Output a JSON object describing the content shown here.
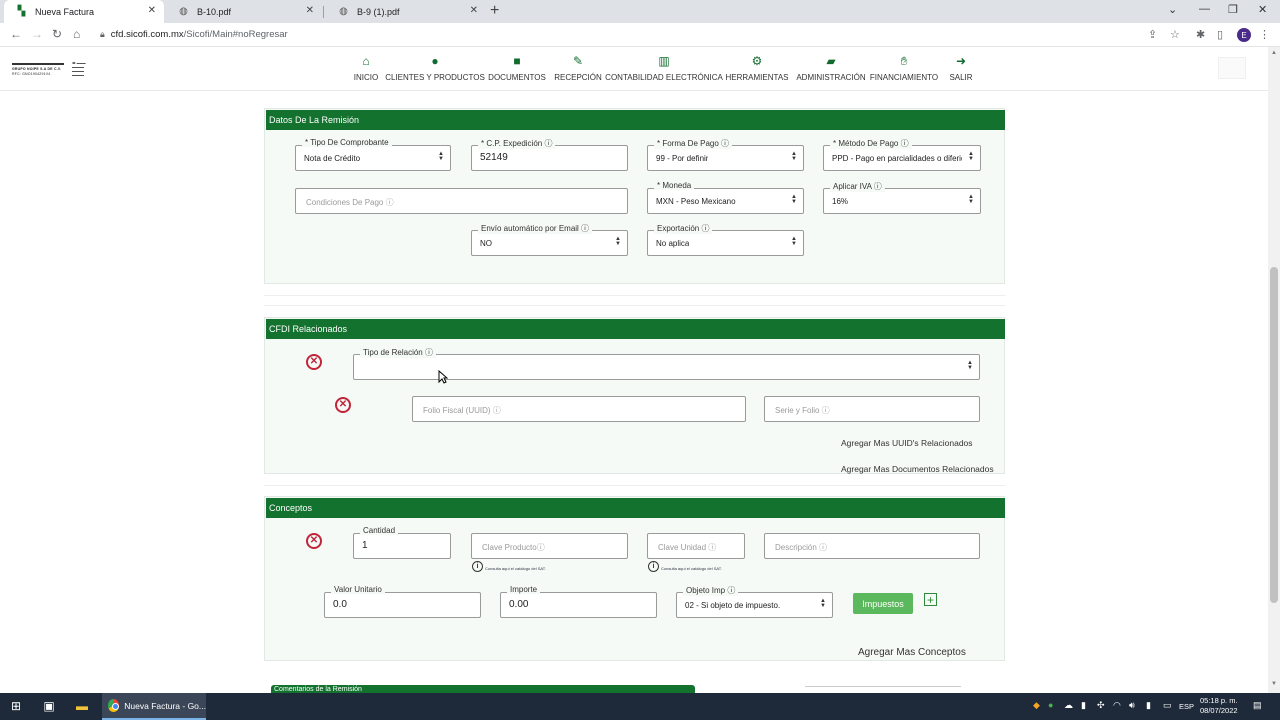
{
  "browser": {
    "tabs": [
      {
        "title": "Nueva Factura",
        "active": true
      },
      {
        "title": "B-10.pdf",
        "active": false
      },
      {
        "title": "B-9 (1).pdf",
        "active": false
      }
    ],
    "url_host": "cfd.sicofi.com.mx",
    "url_path": "/Sicofi/Main#noRegresar",
    "profile_initial": "E"
  },
  "header": {
    "logo_text": "GRUPO NOIPE S.A DE C.V.",
    "logo_subtext": "RFC: GNO1904291V4",
    "nav": [
      {
        "label": "INICIO",
        "icon": "home-icon"
      },
      {
        "label": "CLIENTES Y PRODUCTOS",
        "icon": "user-icon"
      },
      {
        "label": "DOCUMENTOS",
        "icon": "folder-icon"
      },
      {
        "label": "RECEPCIÓN",
        "icon": "edit-icon"
      },
      {
        "label": "CONTABILIDAD ELECTRÓNICA",
        "icon": "chart-icon"
      },
      {
        "label": "HERRAMIENTAS",
        "icon": "gears-icon"
      },
      {
        "label": "ADMINISTRACIÓN",
        "icon": "folder-open-icon"
      },
      {
        "label": "FINANCIAMIENTO",
        "icon": "hand-icon"
      },
      {
        "label": "SALIR",
        "icon": "sign-out-icon"
      }
    ]
  },
  "remision": {
    "title": "Datos De La Remisión",
    "tipo_comprobante": {
      "label": "* Tipo De Comprobante",
      "value": "Nota de Crédito"
    },
    "cp_expedicion": {
      "label": "* C.P. Expedición ⓘ",
      "value": "52149"
    },
    "forma_pago": {
      "label": "* Forma De Pago ⓘ",
      "value": "99 - Por definir"
    },
    "metodo_pago": {
      "label": "* Método De Pago ⓘ",
      "value": "PPD - Pago en parcialidades o diferido"
    },
    "condiciones_pago": {
      "placeholder": "Condiciones De Pago ⓘ"
    },
    "moneda": {
      "label": "* Moneda",
      "value": "MXN - Peso Mexicano"
    },
    "aplicar_iva": {
      "label": "Aplicar IVA ⓘ",
      "value": "16%"
    },
    "envio_email": {
      "label": "Envío automático por Email ⓘ",
      "value": "NO"
    },
    "exportacion": {
      "label": "Exportación ⓘ",
      "value": "No aplica"
    }
  },
  "cfdi": {
    "title": "CFDI Relacionados",
    "tipo_relacion": {
      "label": "Tipo de Relación ⓘ",
      "value": ""
    },
    "folio_fiscal": {
      "placeholder": "Folio Fiscal (UUID) ⓘ"
    },
    "serie_folio": {
      "placeholder": "Serie y Folio ⓘ"
    },
    "add_uuids": "Agregar Mas UUID's Relacionados",
    "add_docs": "Agregar Mas Documentos Relacionados"
  },
  "conceptos": {
    "title": "Conceptos",
    "cantidad": {
      "label": "Cantidad",
      "value": "1"
    },
    "clave_producto": {
      "placeholder": "Clave Productoⓘ"
    },
    "clave_unidad": {
      "placeholder": "Clave Unidad ⓘ"
    },
    "descripcion": {
      "placeholder": "Descripción ⓘ"
    },
    "sat_note": "Consulta aquí el catálogo del SAT.",
    "valor_unitario": {
      "label": "Valor Unitario",
      "value": "0.0"
    },
    "importe": {
      "label": "Importe",
      "value": "0.00"
    },
    "objeto_imp": {
      "label": "Objeto Imp ⓘ",
      "value": "02 - Si objeto de impuesto."
    },
    "impuestos_button": "Impuestos",
    "add_conceptos": "Agregar Mas Conceptos"
  },
  "comentarios": {
    "title": "Comentarios de la Remisión"
  },
  "taskbar": {
    "app_label": "Nueva Factura - Go...",
    "lang": "ESP",
    "time": "05:18 p. m.",
    "date": "08/07/2022"
  },
  "colors": {
    "brand_green": "#12722e",
    "button_green": "#5cb85c",
    "delete_red": "#c0253a"
  }
}
